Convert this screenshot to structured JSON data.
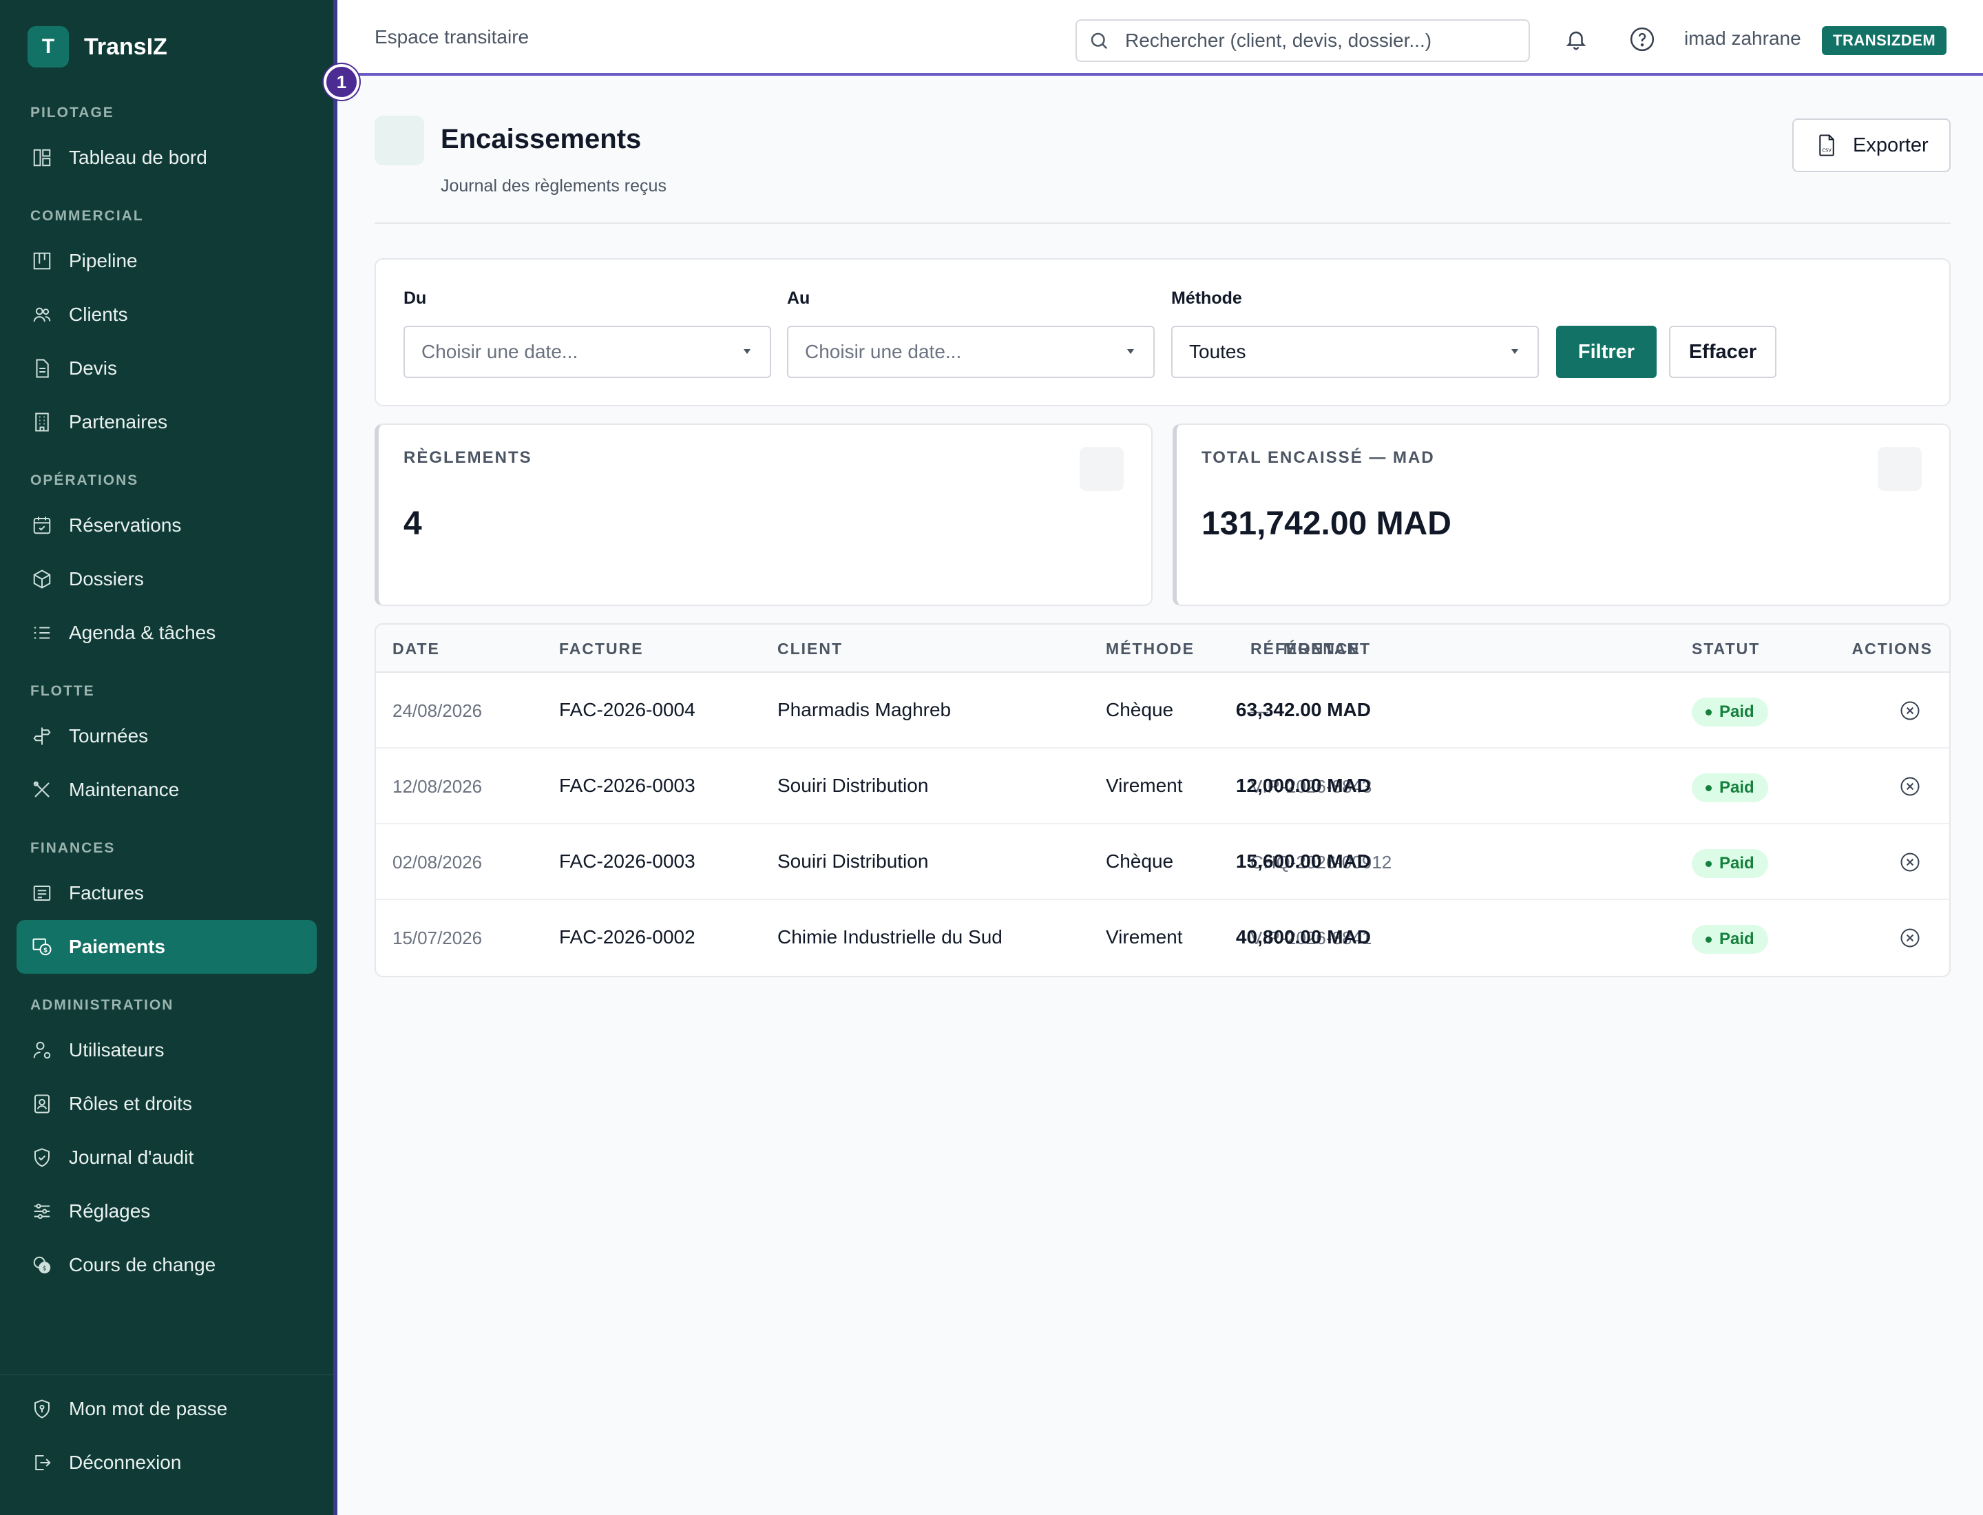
{
  "app": {
    "logo_letter": "T",
    "name": "TransIZ"
  },
  "sidebar": {
    "sections": [
      {
        "title": "PILOTAGE",
        "items": [
          {
            "label": "Tableau de bord",
            "icon": "dashboard-icon"
          }
        ]
      },
      {
        "title": "COMMERCIAL",
        "items": [
          {
            "label": "Pipeline",
            "icon": "kanban-icon"
          },
          {
            "label": "Clients",
            "icon": "users-icon"
          },
          {
            "label": "Devis",
            "icon": "document-icon"
          },
          {
            "label": "Partenaires",
            "icon": "building-icon"
          }
        ]
      },
      {
        "title": "OPÉRATIONS",
        "items": [
          {
            "label": "Réservations",
            "icon": "calendar-check-icon"
          },
          {
            "label": "Dossiers",
            "icon": "package-icon"
          },
          {
            "label": "Agenda & tâches",
            "icon": "list-icon"
          }
        ]
      },
      {
        "title": "FLOTTE",
        "items": [
          {
            "label": "Tournées",
            "icon": "signpost-icon"
          },
          {
            "label": "Maintenance",
            "icon": "tools-icon"
          }
        ]
      },
      {
        "title": "FINANCES",
        "items": [
          {
            "label": "Factures",
            "icon": "invoice-icon"
          },
          {
            "label": "Paiements",
            "icon": "payment-icon",
            "active": true
          }
        ]
      },
      {
        "title": "ADMINISTRATION",
        "items": [
          {
            "label": "Utilisateurs",
            "icon": "user-cog-icon"
          },
          {
            "label": "Rôles et droits",
            "icon": "badge-icon"
          },
          {
            "label": "Journal d'audit",
            "icon": "shield-check-icon"
          },
          {
            "label": "Réglages",
            "icon": "sliders-icon"
          },
          {
            "label": "Cours de change",
            "icon": "coins-icon"
          }
        ]
      }
    ],
    "bottom": [
      {
        "label": "Mon mot de passe",
        "icon": "shield-key-icon"
      },
      {
        "label": "Déconnexion",
        "icon": "logout-icon"
      }
    ]
  },
  "topbar": {
    "space_label": "Espace transitaire",
    "search_placeholder": "Rechercher (client, devis, dossier...)",
    "username": "imad zahrane",
    "tenant": "TRANSIZDEM",
    "step_badge": "1"
  },
  "page": {
    "title": "Encaissements",
    "subtitle": "Journal des règlements reçus",
    "export_label": "Exporter"
  },
  "filters": {
    "from_label": "Du",
    "from_placeholder": "Choisir une date...",
    "to_label": "Au",
    "to_placeholder": "Choisir une date...",
    "method_label": "Méthode",
    "method_value": "Toutes",
    "filter_button": "Filtrer",
    "clear_button": "Effacer"
  },
  "stats": {
    "count_label": "RÈGLEMENTS",
    "count_value": "4",
    "total_label": "TOTAL ENCAISSÉ — MAD",
    "total_value": "131,742.00 MAD"
  },
  "table": {
    "headers": [
      "DATE",
      "FACTURE",
      "CLIENT",
      "MÉTHODE",
      "RÉFÉRENCE",
      "MONTANT",
      "STATUT",
      "ACTIONS"
    ],
    "rows": [
      {
        "date": "24/08/2026",
        "invoice": "FAC-2026-0004",
        "client": "Pharmadis Maghreb",
        "method": "Chèque",
        "reference": "—",
        "amount": "63,342.00 MAD",
        "status": "Paid"
      },
      {
        "date": "12/08/2026",
        "invoice": "FAC-2026-0003",
        "client": "Souiri Distribution",
        "method": "Virement",
        "reference": "VIR-2026-8843",
        "amount": "12,000.00 MAD",
        "status": "Paid"
      },
      {
        "date": "02/08/2026",
        "invoice": "FAC-2026-0003",
        "client": "Souiri Distribution",
        "method": "Chèque",
        "reference": "CHQ-2026-00912",
        "amount": "15,600.00 MAD",
        "status": "Paid"
      },
      {
        "date": "15/07/2026",
        "invoice": "FAC-2026-0002",
        "client": "Chimie Industrielle du Sud",
        "method": "Virement",
        "reference": "VIR-2026-8841",
        "amount": "40,800.00 MAD",
        "status": "Paid"
      }
    ]
  },
  "colors": {
    "sidebar_bg": "#0f3a35",
    "accent": "#137266",
    "status_paid_bg": "#dcfce7",
    "status_paid_text": "#15803d"
  }
}
